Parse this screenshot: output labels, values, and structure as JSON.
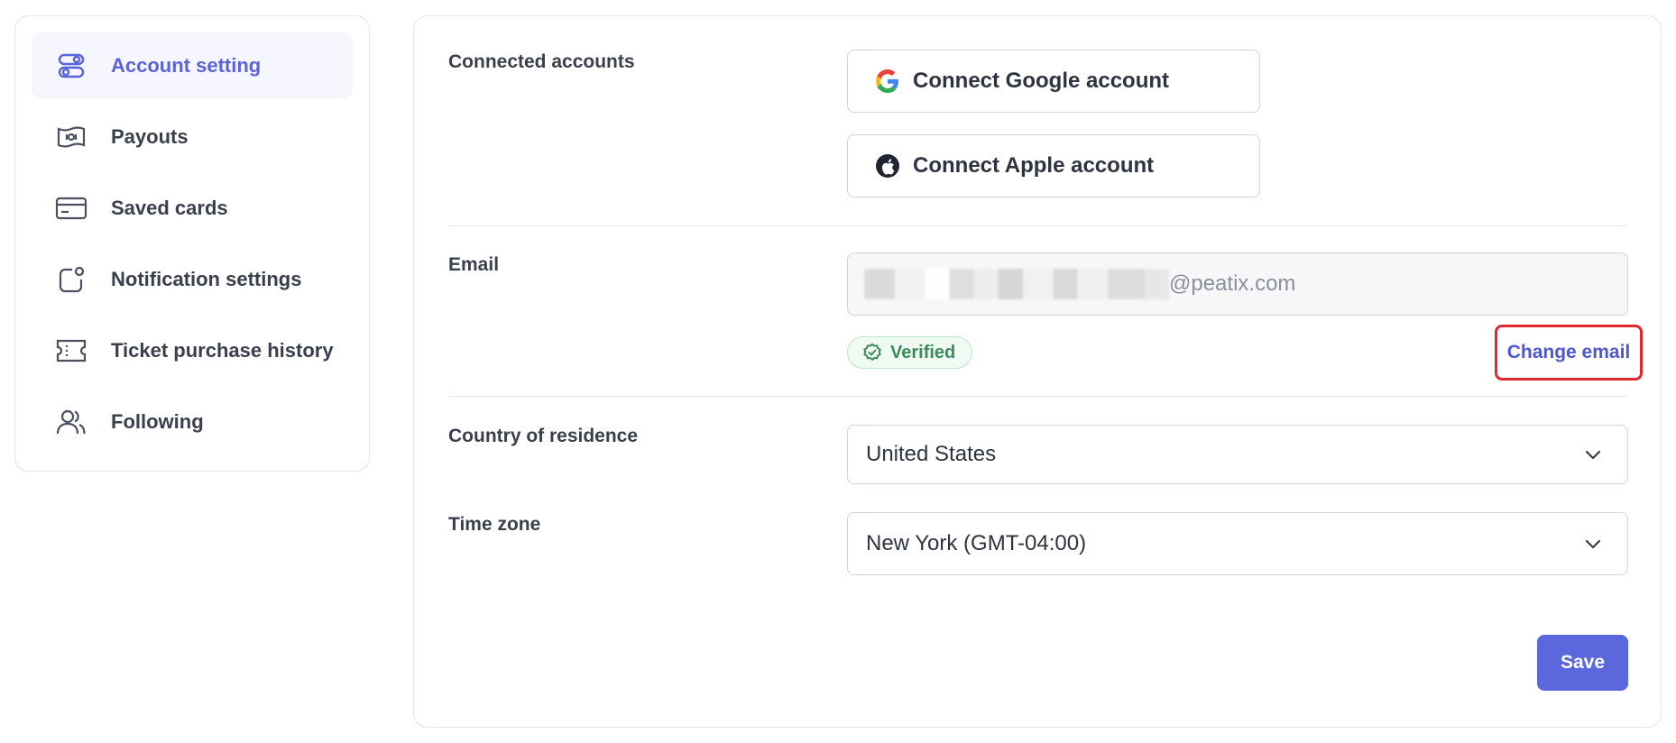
{
  "sidebar": {
    "items": [
      {
        "label": "Account setting",
        "icon": "toggles-icon",
        "active": true
      },
      {
        "label": "Payouts",
        "icon": "cash-icon",
        "active": false
      },
      {
        "label": "Saved cards",
        "icon": "credit-card-icon",
        "active": false
      },
      {
        "label": "Notification settings",
        "icon": "notification-icon",
        "active": false
      },
      {
        "label": "Ticket purchase history",
        "icon": "ticket-icon",
        "active": false
      },
      {
        "label": "Following",
        "icon": "users-icon",
        "active": false
      }
    ]
  },
  "connected_accounts": {
    "label": "Connected accounts",
    "google_label": "Connect Google account",
    "apple_label": "Connect Apple account"
  },
  "email": {
    "label": "Email",
    "value_domain": "@peatix.com",
    "verified_label": "Verified",
    "change_label": "Change email"
  },
  "country": {
    "label": "Country of residence",
    "value": "United States"
  },
  "timezone": {
    "label": "Time zone",
    "value": "New York (GMT-04:00)"
  },
  "save_label": "Save",
  "colors": {
    "accent": "#5a67dd",
    "active_bg": "#f5f6ff",
    "verified_green": "#3f8a5c",
    "highlight_red": "#e0292e"
  }
}
